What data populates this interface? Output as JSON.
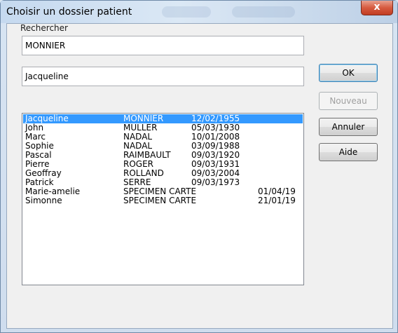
{
  "window": {
    "title": "Choisir un dossier patient",
    "close_glyph": "x"
  },
  "search": {
    "label": "Rechercher",
    "lastname_value": "MONNIER",
    "firstname_value": "Jacqueline"
  },
  "patients": [
    {
      "first": "Jacqueline",
      "last": "MONNIER",
      "dob": "12/02/1955",
      "extra": "",
      "selected": true
    },
    {
      "first": "John",
      "last": "MULLER",
      "dob": "05/03/1930",
      "extra": ""
    },
    {
      "first": "Marc",
      "last": "NADAL",
      "dob": "10/01/2008",
      "extra": ""
    },
    {
      "first": "Sophie",
      "last": "NADAL",
      "dob": "03/09/1988",
      "extra": ""
    },
    {
      "first": "Pascal",
      "last": "RAIMBAULT",
      "dob": "09/03/1920",
      "extra": ""
    },
    {
      "first": "Pierre",
      "last": "ROGER",
      "dob": "09/03/1931",
      "extra": ""
    },
    {
      "first": "Geoffray",
      "last": "ROLLAND",
      "dob": "09/03/2004",
      "extra": ""
    },
    {
      "first": "Patrick",
      "last": "SERRE",
      "dob": "09/03/1973",
      "extra": ""
    },
    {
      "first": "Marie-amelie",
      "last": "SPECIMEN CARTE",
      "dob": "",
      "extra": "01/04/19"
    },
    {
      "first": "Simonne",
      "last": "SPECIMEN CARTE",
      "dob": "",
      "extra": "21/01/19"
    }
  ],
  "buttons": {
    "ok": "OK",
    "nouveau": "Nouveau",
    "annuler": "Annuler",
    "aide": "Aide"
  },
  "colors": {
    "selection": "#3399ff",
    "close_button": "#d65a3f"
  }
}
